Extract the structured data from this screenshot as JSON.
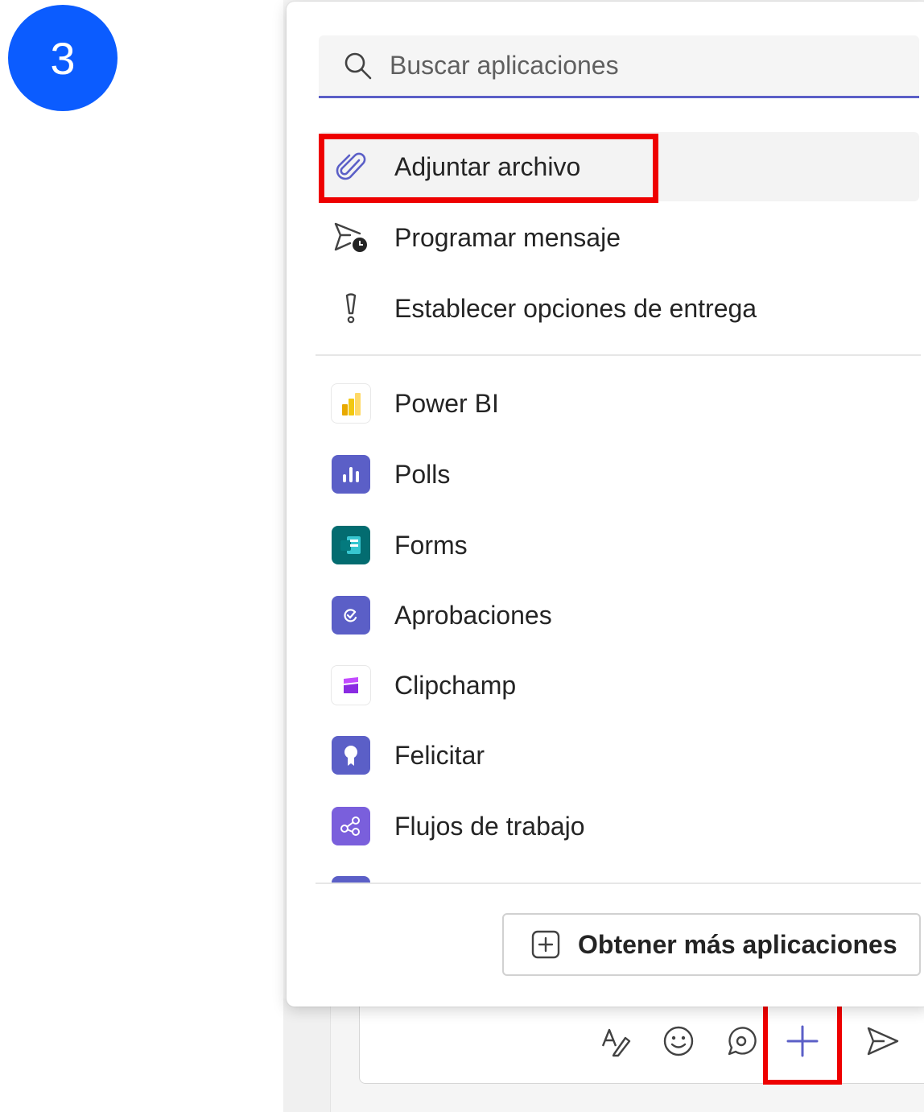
{
  "step_badge": "3",
  "search": {
    "placeholder": "Buscar aplicaciones",
    "icon": "search-icon"
  },
  "actions": [
    {
      "label": "Adjuntar archivo",
      "icon": "paperclip-icon",
      "selected": true
    },
    {
      "label": "Programar mensaje",
      "icon": "schedule-send-icon"
    },
    {
      "label": "Establecer opciones de entrega",
      "icon": "important-icon"
    }
  ],
  "apps": [
    {
      "label": "Power BI",
      "icon": "power-bi-icon",
      "color": "#f2c811"
    },
    {
      "label": "Polls",
      "icon": "polls-icon",
      "color": "#5b5fc7"
    },
    {
      "label": "Forms",
      "icon": "forms-icon",
      "color": "#036c70"
    },
    {
      "label": "Aprobaciones",
      "icon": "approvals-icon",
      "color": "#5b5fc7"
    },
    {
      "label": "Clipchamp",
      "icon": "clipchamp-icon",
      "color": "#9b30ff"
    },
    {
      "label": "Felicitar",
      "icon": "praise-icon",
      "color": "#5b5fc7"
    },
    {
      "label": "Flujos de trabajo",
      "icon": "workflows-icon",
      "color": "#7a5fdc"
    }
  ],
  "get_more": {
    "label": "Obtener más aplicaciones",
    "icon": "add-square-icon"
  },
  "toolbar": {
    "icons": [
      "format-icon",
      "emoji-icon",
      "loop-icon",
      "plus-icon",
      "send-icon"
    ]
  },
  "colors": {
    "accent": "#5b5fc7",
    "highlight": "#ee0000",
    "badge": "#0b5cff"
  }
}
